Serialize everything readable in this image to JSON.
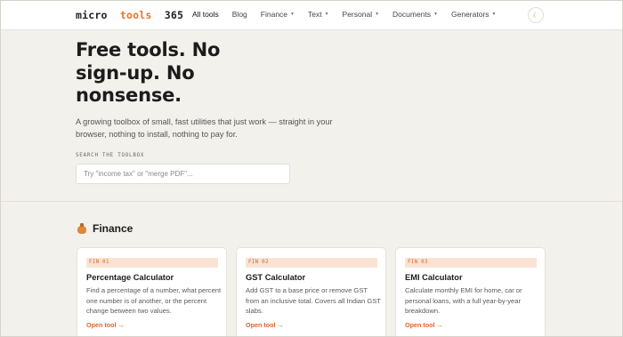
{
  "header": {
    "logo": {
      "part1": "micro",
      "part2": "tools",
      "part3": "365"
    },
    "nav": [
      {
        "label": "All tools",
        "dropdown": false,
        "active": true
      },
      {
        "label": "Blog",
        "dropdown": false
      },
      {
        "label": "Finance",
        "dropdown": true
      },
      {
        "label": "Text",
        "dropdown": true
      },
      {
        "label": "Personal",
        "dropdown": true
      },
      {
        "label": "Documents",
        "dropdown": true
      },
      {
        "label": "Generators",
        "dropdown": true
      }
    ],
    "theme_icon": "moon-icon"
  },
  "hero": {
    "title": "Free tools. No sign-up. No nonsense.",
    "lead": "A growing toolbox of small, fast utilities that just work — straight in your browser, nothing to install, nothing to pay for.",
    "search_label": "SEARCH THE TOOLBOX",
    "search_placeholder": "Try \"income tax\" or \"merge PDF\"..."
  },
  "section": {
    "icon": "money-bag-icon",
    "title": "Finance",
    "cards": [
      {
        "tag": "FIN 01",
        "title": "Percentage Calculator",
        "desc": "Find a percentage of a number, what percent one number is of another, or the percent change between two values.",
        "link": "Open tool →"
      },
      {
        "tag": "FIN 02",
        "title": "GST Calculator",
        "desc": "Add GST to a base price or remove GST from an inclusive total. Covers all Indian GST slabs.",
        "link": "Open tool →"
      },
      {
        "tag": "FIN 03",
        "title": "EMI Calculator",
        "desc": "Calculate monthly EMI for home, car or personal loans, with a full year-by-year breakdown.",
        "link": "Open tool →"
      }
    ]
  },
  "colors": {
    "accent": "#e8742c",
    "page_bg": "#f3f1ec",
    "tag_bg": "#fbe3d3"
  }
}
